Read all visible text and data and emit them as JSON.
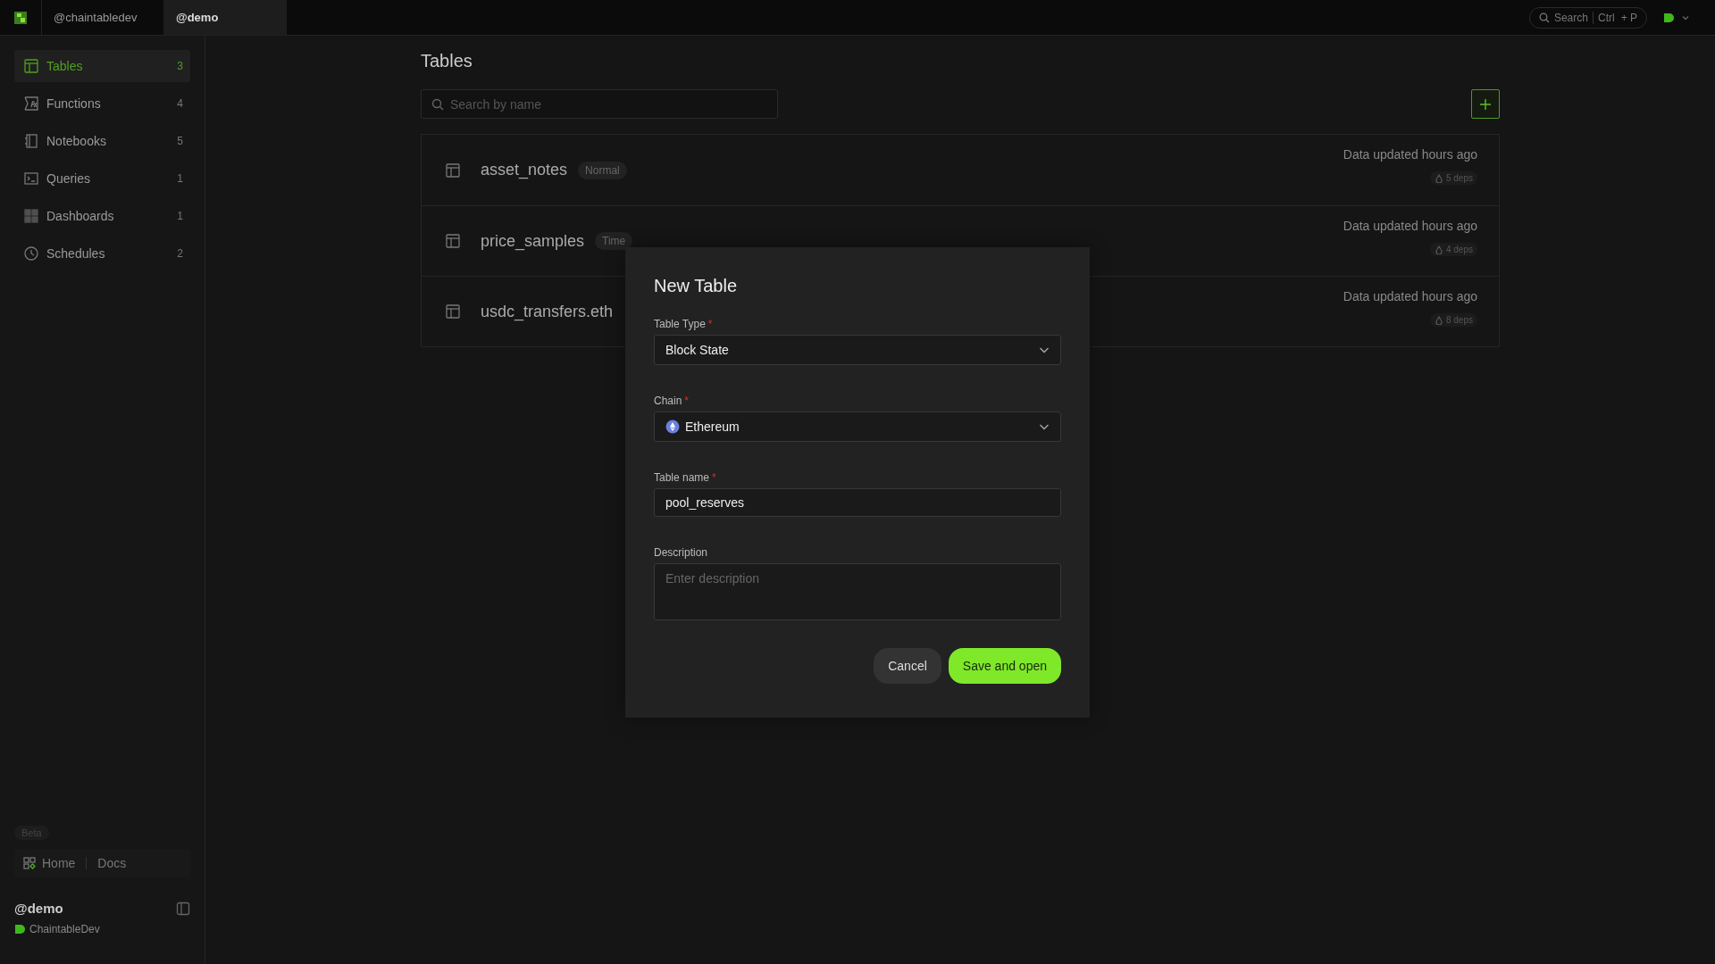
{
  "app_tabs": [
    {
      "label": "@chaintabledev",
      "selected": false
    },
    {
      "label": "@demo",
      "selected": true
    }
  ],
  "top_search": {
    "label": "Search",
    "keys": [
      "Ctrl",
      "+ P"
    ]
  },
  "sidebar": {
    "items": [
      {
        "kind": "table",
        "label": "Tables",
        "count": "3",
        "selected": true
      },
      {
        "kind": "function",
        "label": "Functions",
        "count": "4",
        "selected": false
      },
      {
        "kind": "notebook",
        "label": "Notebooks",
        "count": "5",
        "selected": false
      },
      {
        "kind": "query",
        "label": "Queries",
        "count": "1",
        "selected": false
      },
      {
        "kind": "dashboard",
        "label": "Dashboards",
        "count": "1",
        "selected": false
      },
      {
        "kind": "schedule",
        "label": "Schedules",
        "count": "2",
        "selected": false
      }
    ],
    "badge": "Beta",
    "links": [
      "Home",
      "Docs"
    ],
    "workspace": {
      "name": "@demo",
      "org": "ChaintableDev"
    }
  },
  "main": {
    "title": "Tables",
    "search": {
      "placeholder": "Search by name"
    },
    "tables": [
      {
        "name": "asset_notes",
        "type": "Normal",
        "updated": "Data updated hours ago",
        "deps": "5 deps"
      },
      {
        "name": "price_samples",
        "type": "Time",
        "updated": "Data updated hours ago",
        "deps": "4 deps"
      },
      {
        "name": "usdc_transfers.eth",
        "updated": "Data updated hours ago",
        "deps": "8 deps"
      }
    ]
  },
  "modal": {
    "title": "New Table",
    "fields": [
      {
        "kind": "select",
        "label": "Table Type",
        "required_mark": "*",
        "value": "Block State",
        "logo": false
      },
      {
        "kind": "select",
        "label": "Chain",
        "required_mark": "*",
        "value": "Ethereum",
        "logo": true
      },
      {
        "kind": "input",
        "label": "Table name",
        "required_mark": "*",
        "value": "pool_reserves"
      },
      {
        "kind": "textarea",
        "label": "Description",
        "placeholder": "Enter description"
      }
    ],
    "buttons": [
      {
        "kind": "secondary",
        "label": "Cancel"
      },
      {
        "kind": "primary",
        "label": "Save and open"
      }
    ]
  }
}
